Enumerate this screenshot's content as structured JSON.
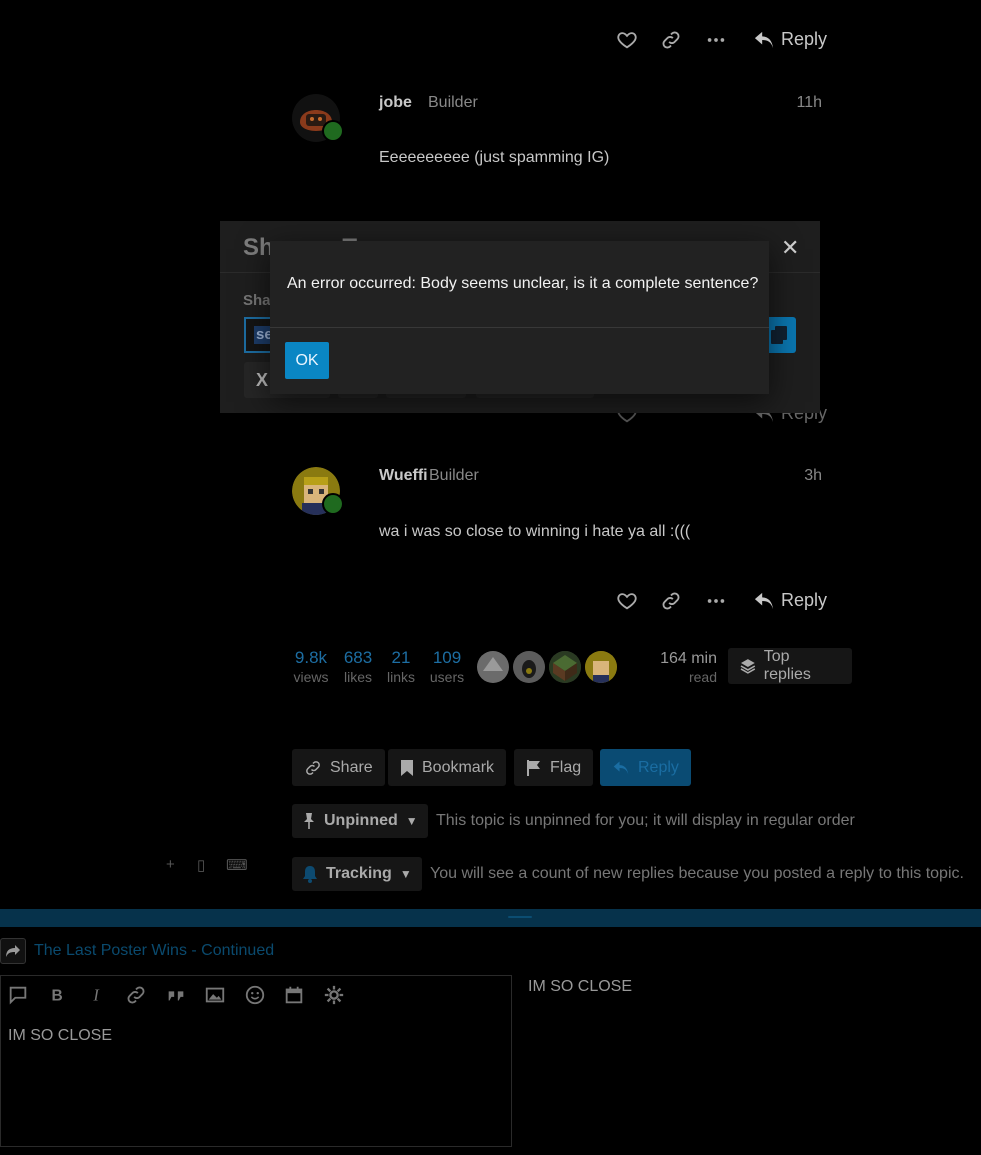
{
  "posts": [
    {
      "username": "jobe",
      "user_title": "Builder",
      "age": "11h",
      "body": "Eeeeeeeeee (just spamming IG)"
    },
    {
      "username": "Wueffi",
      "user_title": "Builder",
      "age": "3h",
      "body": "wa i was so close to winning i hate ya all :((("
    }
  ],
  "post_actions": {
    "reply_label": "Reply",
    "icons": [
      "heart-icon",
      "link-icon",
      "ellipsis-icon",
      "reply-icon"
    ]
  },
  "topic_stats": {
    "views": {
      "value": "9.8k",
      "label": "views"
    },
    "likes": {
      "value": "683",
      "label": "likes"
    },
    "links": {
      "value": "21",
      "label": "links"
    },
    "users": {
      "value": "109",
      "label": "users"
    },
    "read_time": {
      "value": "164 min",
      "label": "read"
    },
    "top_replies_label": "Top replies"
  },
  "topic_buttons": {
    "share": "Share",
    "bookmark": "Bookmark",
    "flag": "Flag",
    "reply": "Reply"
  },
  "pin_status": {
    "label": "Unpinned",
    "description": "This topic is unpinned for you; it will display in regular order"
  },
  "tracking_status": {
    "label": "Tracking",
    "description": "You will see a count of new replies because you posted a reply to this topic."
  },
  "composer": {
    "reply_to_title": "The Last Poster Wins - Continued",
    "content": "IM SO CLOSE",
    "preview": "IM SO CLOSE",
    "toolbar_icons": [
      "quote-icon",
      "bold-icon",
      "italic-icon",
      "link-icon",
      "blockquote-icon",
      "image-icon",
      "emoji-icon",
      "calendar-icon",
      "gear-icon"
    ]
  },
  "share_modal": {
    "title_partial": "Sh",
    "title_partial_2": "To",
    "link_label_partial": "Sha",
    "url_selected_partial": "se",
    "x_button": "X"
  },
  "error_dialog": {
    "message": "An error occurred: Body seems unclear, is it a complete sentence?",
    "ok_label": "OK"
  },
  "colors": {
    "accent": "#0a86c4",
    "presence": "#1f6a1f",
    "link_dim": "#1d6ea3"
  }
}
